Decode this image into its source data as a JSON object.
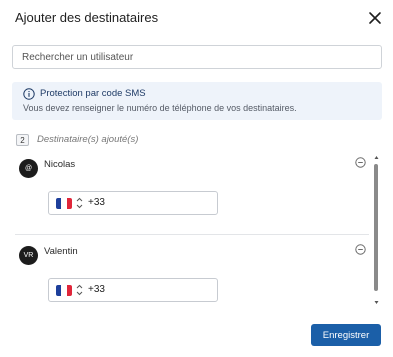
{
  "dialog": {
    "title": "Ajouter des destinataires",
    "close_icon": "close-icon"
  },
  "search": {
    "placeholder": "Rechercher un utilisateur",
    "value": ""
  },
  "info_box": {
    "icon": "info-icon",
    "title": "Protection par code SMS",
    "text": "Vous devez renseigner le numéro de téléphone de vos destinataires."
  },
  "recipients_header": {
    "count": "2",
    "label": "Destinataire(s) ajouté(s)"
  },
  "recipients": [
    {
      "avatar": "@",
      "name": "Nicolas",
      "phone": {
        "flag": "flag-fr-icon",
        "dial_code": "+33",
        "value": ""
      },
      "remove_icon": "remove-circle-icon"
    },
    {
      "avatar": "VR",
      "name": "Valentin",
      "phone": {
        "flag": "flag-fr-icon",
        "dial_code": "+33",
        "value": ""
      },
      "remove_icon": "remove-circle-icon"
    }
  ],
  "footer": {
    "save_label": "Enregistrer"
  },
  "colors": {
    "primary": "#1b5fa8",
    "info_bg": "#eef3fa",
    "avatar_bg": "#1c1c1c",
    "flag_blue": "#1d3f9b",
    "flag_white": "#ffffff",
    "flag_red": "#e0263a"
  }
}
